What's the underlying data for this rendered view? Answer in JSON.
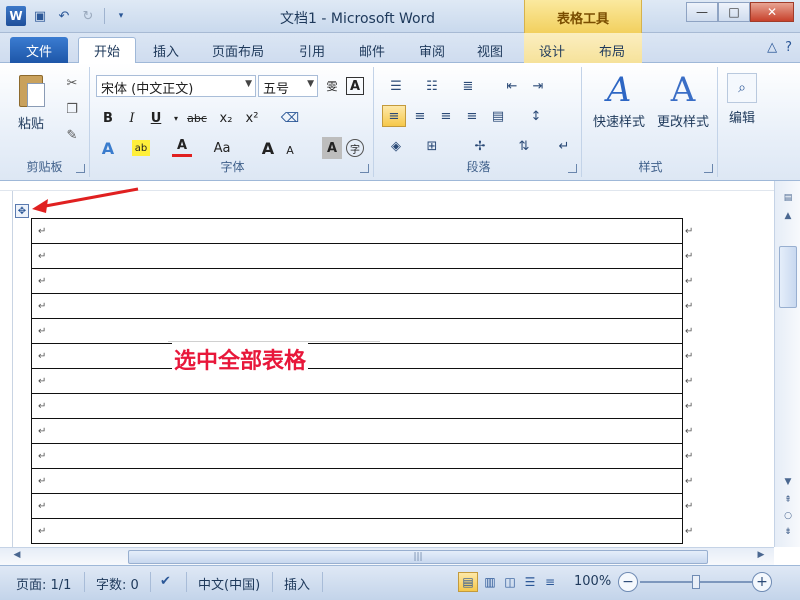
{
  "window": {
    "title": "文档1 - Microsoft Word",
    "context_tab_group": "表格工具",
    "app_icon_letter": "W"
  },
  "tabs": {
    "file": "文件",
    "items": [
      "开始",
      "插入",
      "页面布局",
      "引用",
      "邮件",
      "审阅",
      "视图",
      "设计",
      "布局"
    ]
  },
  "ribbon": {
    "clipboard": {
      "paste": "粘贴",
      "group_label": "剪贴板"
    },
    "font": {
      "font_name": "宋体 (中文正文)",
      "font_size": "五号",
      "group_label": "字体",
      "buttons": [
        "B",
        "I",
        "U",
        "abc",
        "x₂",
        "x²"
      ],
      "size_buttons": [
        "A",
        "A",
        "Aa"
      ]
    },
    "paragraph": {
      "group_label": "段落"
    },
    "styles": {
      "quick_styles": "快速样式",
      "change_styles": "更改样式",
      "group_label": "样式"
    },
    "editing": {
      "label": "编辑"
    }
  },
  "document": {
    "row_count": 13,
    "annotation": "选中全部表格"
  },
  "statusbar": {
    "page": "页面: 1/1",
    "words": "字数: 0",
    "language": "中文(中国)",
    "mode": "插入",
    "zoom": "100%"
  },
  "colors": {
    "accent": "#2b5797",
    "annotation": "#e8173a",
    "context_tab": "#f2d05e"
  }
}
